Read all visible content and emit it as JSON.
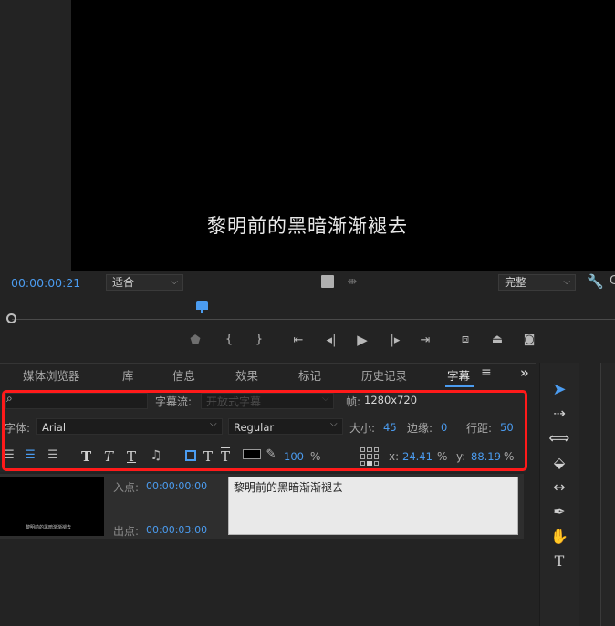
{
  "monitor": {
    "caption_overlay": "黎明前的黑暗渐渐褪去",
    "timecode": "00:00:00:21",
    "fit_label": "适合",
    "quality_label": "完整",
    "right_cut_letter": "C"
  },
  "panel": {
    "tabs": [
      "媒体浏览器",
      "库",
      "信息",
      "效果",
      "标记",
      "历史记录",
      "字幕"
    ],
    "menu_icon": "≡",
    "overflow_icon": "»"
  },
  "caption_toolbar": {
    "stream_label": "字幕流:",
    "stream_value": "开放式字幕",
    "frame_label": "帧:",
    "frame_value": "1280x720",
    "font_label": "字体:",
    "font_value": "Arial",
    "style_value": "Regular",
    "size_label": "大小:",
    "size_value": "45",
    "edge_label": "边缘:",
    "edge_value": "0",
    "line_spacing_label": "行距:",
    "line_spacing_value": "50",
    "opacity_value": "100",
    "percent": "%",
    "x_label": "x:",
    "x_value": "24.41",
    "y_label": "y:",
    "y_value": "88.19",
    "fill_color": "#000000"
  },
  "caption_list": {
    "in_label": "入点:",
    "in_value": "00:00:00:00",
    "out_label": "出点:",
    "out_value": "00:00:03:00",
    "caption_text": "黎明前的黑暗渐渐褪去",
    "thumb_text": "黎明前的黑暗渐渐褪去"
  },
  "colors": {
    "accent": "#4b9cf0",
    "highlight_box": "#ff1a1a"
  }
}
